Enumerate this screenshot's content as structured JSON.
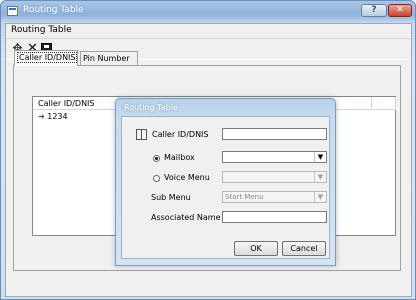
{
  "window": {
    "title": "Routing Table"
  },
  "menu": {
    "items": [
      "Routing Table"
    ]
  },
  "toolbar": {
    "add_icon": "plus-icon",
    "delete_icon": "x-icon",
    "save_icon": "disk-icon"
  },
  "tabs": [
    {
      "label": "Caller ID/DNIS"
    },
    {
      "label": "Pin Number"
    }
  ],
  "table": {
    "headers": [
      "Caller ID/DNIS",
      "",
      ""
    ],
    "rows": [
      {
        "caller_id": "1234"
      }
    ]
  },
  "dialog": {
    "title": "Routing Table",
    "caller_label": "Caller ID/DNIS",
    "caller_value": "",
    "mailbox_label": "Mailbox",
    "voice_menu_label": "Voice Menu",
    "sub_menu_label": "Sub Menu",
    "sub_menu_value": "Start Menu",
    "associated_name_label": "Associated Name",
    "ok_label": "OK",
    "cancel_label": "Cancel"
  }
}
